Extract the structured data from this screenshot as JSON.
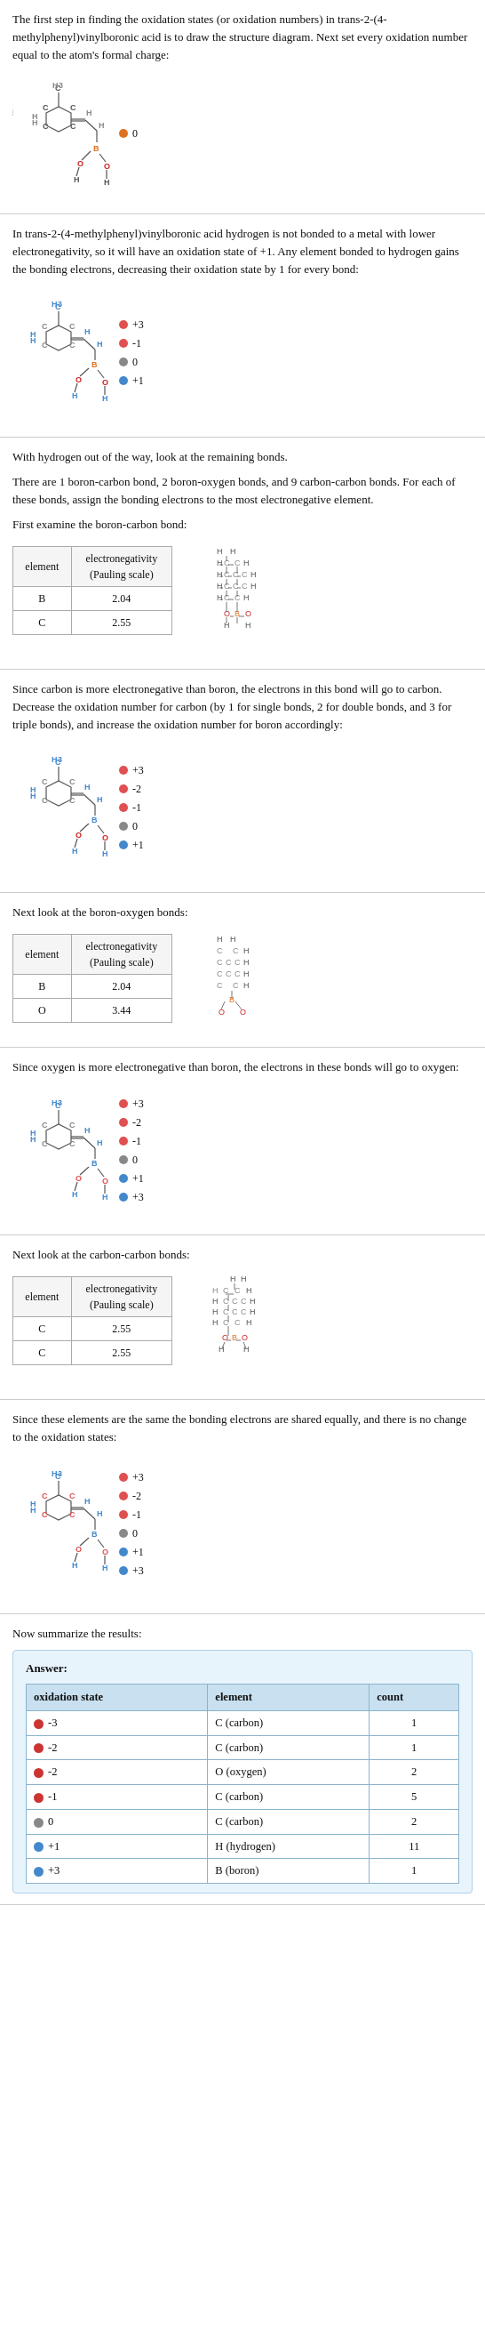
{
  "intro": {
    "text1": "The first step in finding the oxidation states (or oxidation numbers) in trans-2-(4-methylphenyl)vinylboronic acid is to draw the structure diagram. Next set every oxidation number equal to the atom's formal charge:"
  },
  "section1": {
    "legend": [
      {
        "color": "#e07020",
        "label": "0"
      }
    ]
  },
  "section2": {
    "text1": "In trans-2-(4-methylphenyl)vinylboronic acid hydrogen is not bonded to a metal with lower electronegativity, so it will have an oxidation state of +1. Any element bonded to hydrogen gains the bonding electrons, decreasing their oxidation state by 1 for every bond:",
    "legend": [
      {
        "color": "#e05050",
        "label": "+3"
      },
      {
        "color": "#e05050",
        "label": "-1"
      },
      {
        "color": "#888888",
        "label": "0"
      },
      {
        "color": "#4488cc",
        "label": "+1"
      }
    ]
  },
  "section3": {
    "text1": "With hydrogen out of the way, look at the remaining bonds.",
    "text2": "There are 1 boron-carbon bond, 2 boron-oxygen bonds, and 9 carbon-carbon bonds. For each of these bonds, assign the bonding electrons to the most electronegative element.",
    "text3": "First examine the boron-carbon bond:",
    "table": {
      "headers": [
        "element",
        "electronegativity\n(Pauling scale)"
      ],
      "rows": [
        [
          "B",
          "2.04"
        ],
        [
          "C",
          "2.55"
        ]
      ]
    }
  },
  "section4": {
    "text1": "Since carbon is more electronegative than boron, the electrons in this bond will go to carbon. Decrease the oxidation number for carbon (by 1 for single bonds, 2 for double bonds, and 3 for triple bonds), and increase the oxidation number for boron accordingly:",
    "legend": [
      {
        "color": "#e05050",
        "label": "+3"
      },
      {
        "color": "#e05050",
        "label": "-2"
      },
      {
        "color": "#e05050",
        "label": "-1"
      },
      {
        "color": "#888888",
        "label": "0"
      },
      {
        "color": "#4488cc",
        "label": "+1"
      }
    ]
  },
  "section5": {
    "text1": "Next look at the boron-oxygen bonds:",
    "table": {
      "headers": [
        "element",
        "electronegativity\n(Pauling scale)"
      ],
      "rows": [
        [
          "B",
          "2.04"
        ],
        [
          "O",
          "3.44"
        ]
      ]
    }
  },
  "section6": {
    "text1": "Since oxygen is more electronegative than boron, the electrons in these bonds will go to oxygen:",
    "legend": [
      {
        "color": "#e05050",
        "label": "+3"
      },
      {
        "color": "#e05050",
        "label": "-2"
      },
      {
        "color": "#e05050",
        "label": "-1"
      },
      {
        "color": "#888888",
        "label": "0"
      },
      {
        "color": "#4488cc",
        "label": "+1"
      },
      {
        "color": "#4488cc",
        "label": "+3"
      }
    ]
  },
  "section7": {
    "text1": "Next look at the carbon-carbon bonds:",
    "table": {
      "headers": [
        "element",
        "electronegativity\n(Pauling scale)"
      ],
      "rows": [
        [
          "C",
          "2.55"
        ],
        [
          "C",
          "2.55"
        ]
      ]
    }
  },
  "section8": {
    "text1": "Since these elements are the same the bonding electrons are shared equally, and there is no change to the oxidation states:",
    "legend": [
      {
        "color": "#e05050",
        "label": "+3"
      },
      {
        "color": "#e05050",
        "label": "-2"
      },
      {
        "color": "#e05050",
        "label": "-1"
      },
      {
        "color": "#888888",
        "label": "0"
      },
      {
        "color": "#4488cc",
        "label": "+1"
      },
      {
        "color": "#4488cc",
        "label": "+3"
      }
    ]
  },
  "summary": {
    "label": "Answer:",
    "table": {
      "headers": [
        "oxidation state",
        "element",
        "count"
      ],
      "rows": [
        {
          "color": "#cc3333",
          "state": "-3",
          "element": "C (carbon)",
          "count": "1"
        },
        {
          "color": "#cc3333",
          "state": "-2",
          "element": "C (carbon)",
          "count": "1"
        },
        {
          "color": "#cc3333",
          "state": "-2",
          "element": "O (oxygen)",
          "count": "2"
        },
        {
          "color": "#cc3333",
          "state": "-1",
          "element": "C (carbon)",
          "count": "5"
        },
        {
          "color": "#888888",
          "state": "0",
          "element": "C (carbon)",
          "count": "2"
        },
        {
          "color": "#4488cc",
          "state": "+1",
          "element": "H (hydrogen)",
          "count": "11"
        },
        {
          "color": "#4488cc",
          "state": "+3",
          "element": "B (boron)",
          "count": "1"
        }
      ]
    }
  },
  "now_summarize": "Now summarize the results:"
}
